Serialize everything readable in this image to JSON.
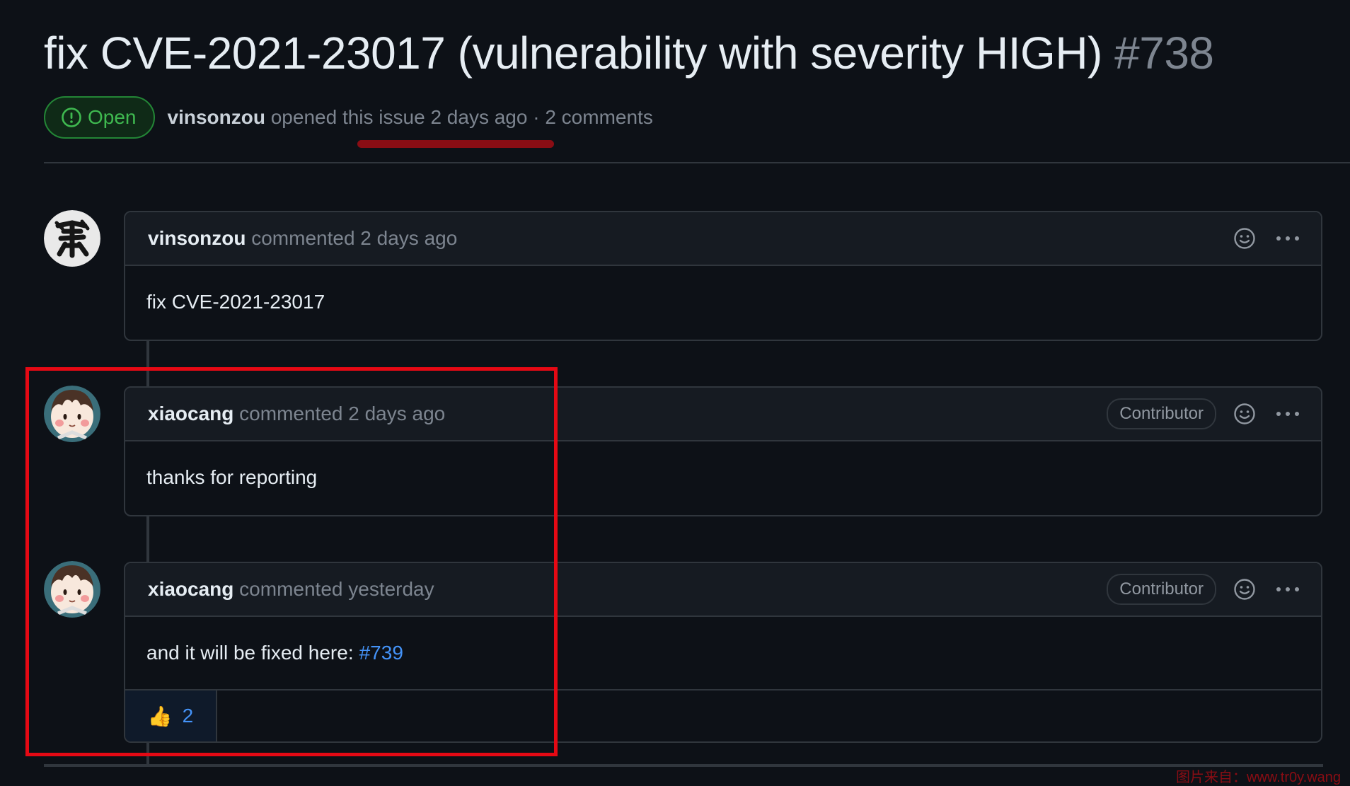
{
  "issue": {
    "title": "fix CVE-2021-23017 (vulnerability with severity HIGH)",
    "number": "#738",
    "status": "Open",
    "author": "vinsonzou",
    "meta": " opened this issue 2 days ago · 2 comments"
  },
  "comments": [
    {
      "author": "vinsonzou",
      "action": "commented 2 days ago",
      "body": "fix CVE-2021-23017",
      "avatar_icon": "chinese-character-avatar"
    },
    {
      "author": "xiaocang",
      "action": "commented 2 days ago",
      "role": "Contributor",
      "body": "thanks for reporting",
      "avatar_icon": "anime-girl-avatar"
    },
    {
      "author": "xiaocang",
      "action": "commented yesterday",
      "role": "Contributor",
      "body": "and it will be fixed here:",
      "link": "#739",
      "reaction": {
        "emoji": "👍",
        "count": "2"
      },
      "avatar_icon": "anime-girl-avatar"
    }
  ],
  "icons": {
    "status": "issue-open-icon",
    "reaction": "smiley-icon",
    "menu": "kebab-icon"
  },
  "colors": {
    "open_green": "#3fb950",
    "link_blue": "#4493f8",
    "highlight_red": "#e50914",
    "background": "#0d1117"
  },
  "watermark": "图片来自：www.tr0y.wang"
}
